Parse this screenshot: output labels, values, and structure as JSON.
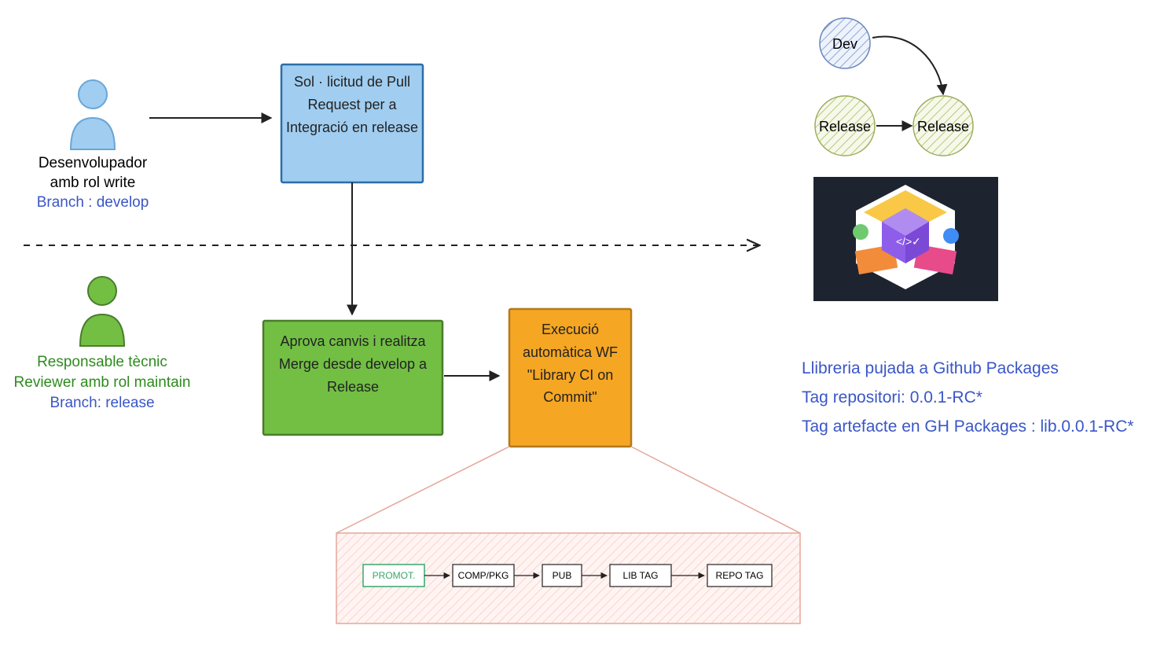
{
  "developer": {
    "title": "Desenvolupador",
    "subtitle": "amb rol write",
    "branch": "Branch : develop"
  },
  "reviewer": {
    "title": "Responsable tècnic",
    "subtitle": "Reviewer amb rol maintain",
    "branch": "Branch: release"
  },
  "boxes": {
    "pr_request": "Sol · licitud de Pull Request per a Integració en release",
    "approve_merge": "Aprova canvis i realitza Merge desde develop a Release",
    "execute_wf": "Execució automàtica WF \"Library CI on Commit\""
  },
  "branches": {
    "dev": "Dev",
    "release1": "Release",
    "release2": "Release"
  },
  "result": {
    "line1": "Llibreria pujada a Github Packages",
    "line2": "Tag repositori: 0.0.1-RC*",
    "line3": "Tag artefacte en GH Packages : lib.0.0.1-RC*"
  },
  "pipeline": {
    "steps": [
      "PROMOT.",
      "COMP/PKG",
      "PUB",
      "LIB TAG",
      "REPO TAG"
    ]
  },
  "colors": {
    "blueFill": "#a0cdf0",
    "blueStroke": "#2b6ea8",
    "greenFill": "#72bf44",
    "greenStroke": "#4a7d2b",
    "orangeFill": "#f5a623",
    "orangeStroke": "#b5781a",
    "textBlue": "#3a56c7",
    "textGreen": "#2e8b1e",
    "pinkish": "#f7d4cf",
    "pinkStroke": "#e6a69c",
    "hatchBlue": "#8aa8d8",
    "hatchGreen": "#b8c97a"
  }
}
